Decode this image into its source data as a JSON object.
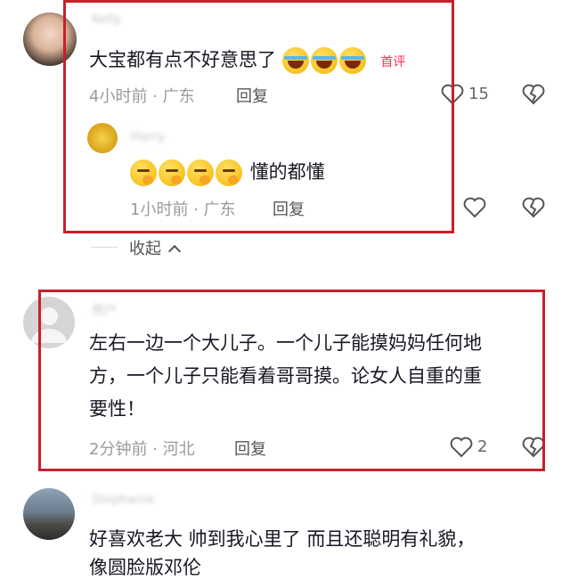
{
  "comments": [
    {
      "username": "Kelly",
      "text": "大宝都有点不好意思了",
      "emojis": [
        "laugh-cry-emoji",
        "laugh-cry-emoji",
        "laugh-cry-emoji"
      ],
      "tag": "首评",
      "time": "4小时前",
      "location": "广东",
      "reply_label": "回复",
      "likes": "15"
    },
    {
      "username": "Harry",
      "text": "懂的都懂",
      "emojis": [
        "thinking-emoji",
        "thinking-emoji",
        "thinking-emoji",
        "thinking-emoji"
      ],
      "time": "1小时前",
      "location": "广东",
      "reply_label": "回复"
    },
    {
      "username": "用户",
      "text_lines": [
        "左右一边一个大儿子。一个儿子能摸妈妈任何地",
        "方，一个儿子只能看着哥哥摸。论女人自重的重",
        "要性！"
      ],
      "time": "2分钟前",
      "location": "河北",
      "reply_label": "回复",
      "likes": "2"
    },
    {
      "username": "Stephanie",
      "text_lines": [
        "好喜欢老大 帅到我心里了 而且还聪明有礼貌，",
        "像圆脸版邓伦"
      ]
    }
  ],
  "collapse_label": "收起",
  "separator": "·",
  "colors": {
    "highlight": "#c8202a",
    "tag": "#fe2c55"
  }
}
